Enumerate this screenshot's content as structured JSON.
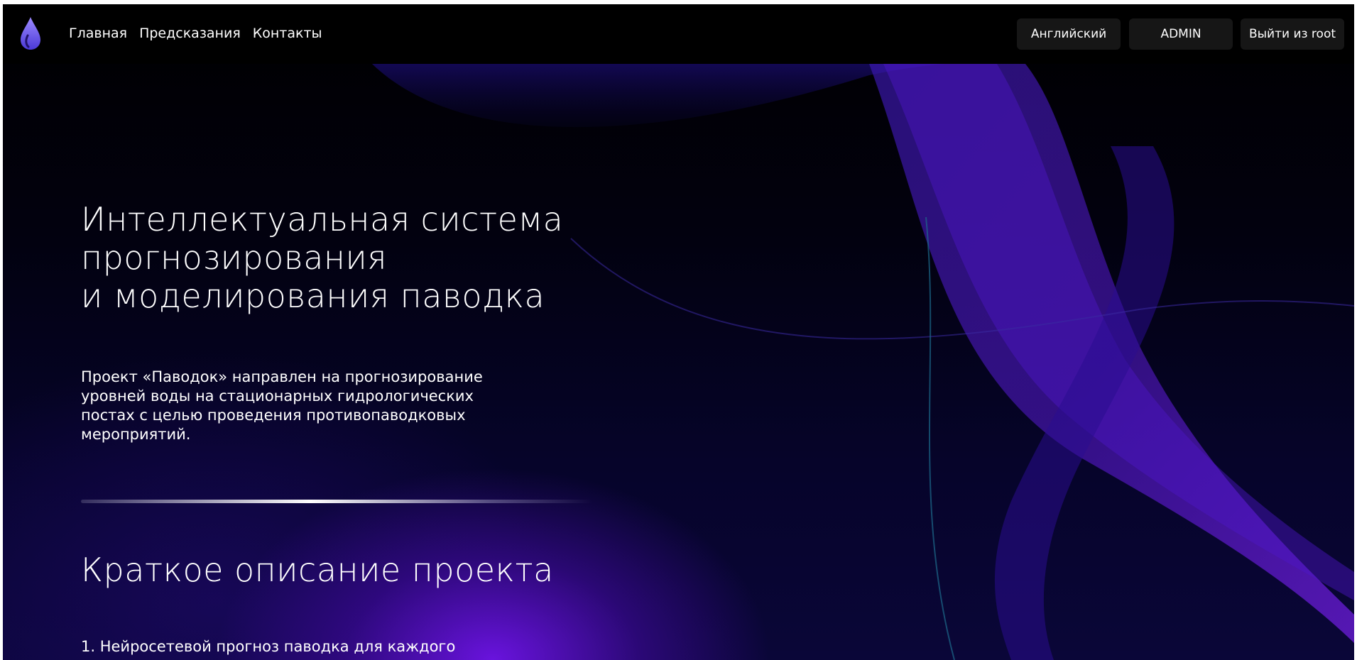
{
  "nav": {
    "logo_icon": "water-drop-icon",
    "items": [
      {
        "label": "Главная"
      },
      {
        "label": "Предсказания"
      },
      {
        "label": "Контакты"
      }
    ]
  },
  "actions": {
    "language_label": "Английский",
    "admin_label": "ADMIN",
    "logout_label": "Выйти из root"
  },
  "hero": {
    "title_lines": [
      "Интеллектуальная система",
      "прогнозирования",
      "и моделирования паводка"
    ],
    "description_lines": [
      "Проект «Паводок» направлен на прогнозирование",
      "уровней воды на стационарных гидрологических",
      "постах с целью проведения противопаводковых",
      "мероприятий."
    ]
  },
  "summary": {
    "title": "Краткое описание проекта",
    "items": [
      {
        "text": "1. Нейросетевой прогноз паводка для каждого"
      }
    ]
  },
  "colors": {
    "background": "#000000",
    "accent": "#6a1fe0",
    "button_bg": "#161616",
    "text": "#ffffff"
  }
}
